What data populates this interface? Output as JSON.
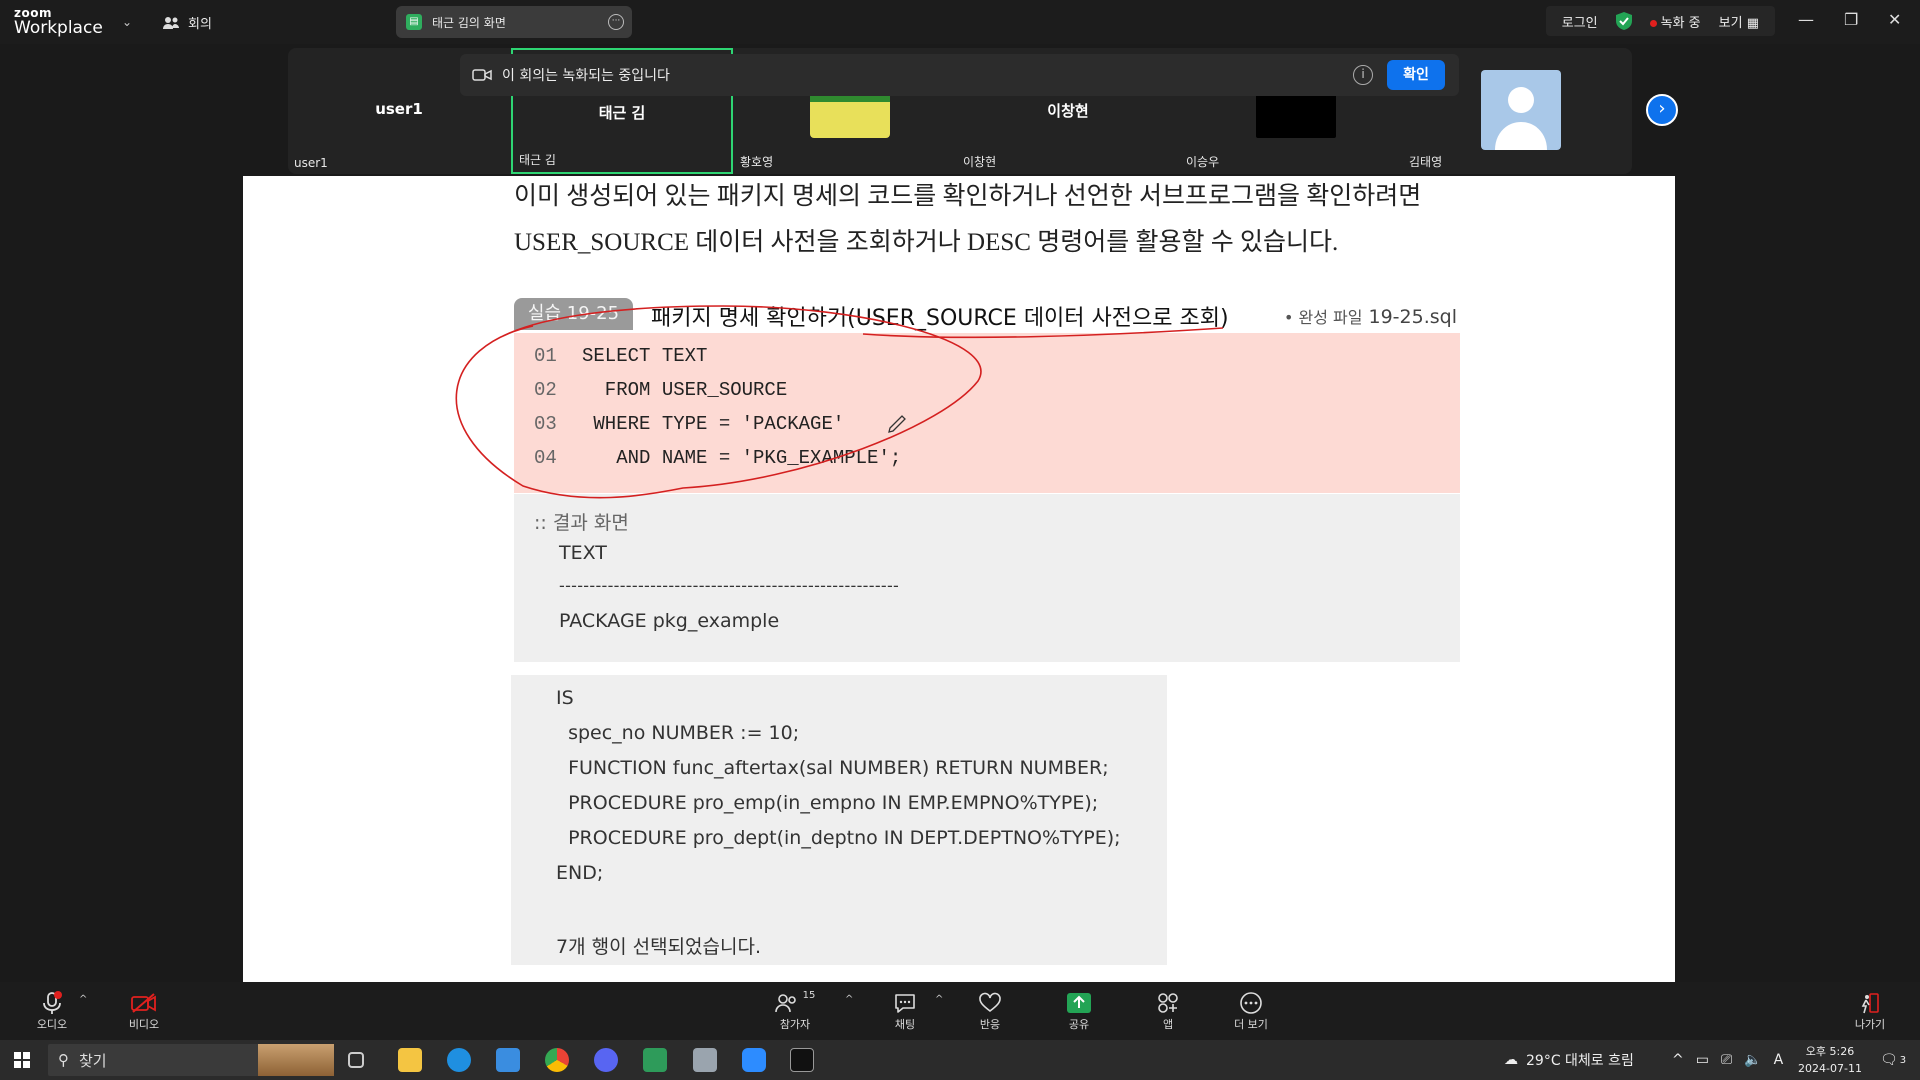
{
  "topbar": {
    "logo_line1": "zoom",
    "logo_line2": "Workplace",
    "meeting_label": "회의",
    "share_title": "태근 김의 화면",
    "login": "로그인",
    "recording": "녹화 중",
    "view": "보기"
  },
  "participants": [
    {
      "name": "user1",
      "label": "user1"
    },
    {
      "name": "태근 김",
      "label": "태근 김"
    },
    {
      "name": "",
      "label": "황호영"
    },
    {
      "name": "이창현",
      "label": "이창현"
    },
    {
      "name": "",
      "label": "이승우"
    },
    {
      "name": "",
      "label": "김태영"
    }
  ],
  "banner": {
    "text": "이 회의는 녹화되는 중입니다",
    "confirm": "확인"
  },
  "document": {
    "para_line1": "이미 생성되어 있는 패키지 명세의 코드를 확인하거나 선언한 서브프로그램을 확인하려면",
    "para_line2": "USER_SOURCE 데이터 사전을 조회하거나 DESC 명령어를 활용할 수 있습니다.",
    "exercise_tag": "실습 19-25",
    "exercise_title": "패키지 명세 확인하기(USER_SOURCE 데이터 사전으로 조회)",
    "file_label": "• 완성 파일",
    "file_name": "19-25.sql",
    "code": [
      {
        "ln": "01",
        "text": "SELECT TEXT"
      },
      {
        "ln": "02",
        "text": "  FROM USER_SOURCE"
      },
      {
        "ln": "03",
        "text": " WHERE TYPE = 'PACKAGE'"
      },
      {
        "ln": "04",
        "text": "   AND NAME = 'PKG_EXAMPLE';"
      }
    ],
    "result_heading": ":: 결과 화면",
    "result_col": "TEXT",
    "result_sep": "--------------------------------------------------------",
    "result_row1": "PACKAGE pkg_example",
    "result_lines": [
      "IS",
      "  spec_no NUMBER := 10;",
      "  FUNCTION func_aftertax(sal NUMBER) RETURN NUMBER;",
      "  PROCEDURE pro_emp(in_empno IN EMP.EMPNO%TYPE);",
      "  PROCEDURE pro_dept(in_deptno IN DEPT.DEPTNO%TYPE);",
      "END;",
      "",
      "7개 행이 선택되었습니다."
    ]
  },
  "toolbar": {
    "audio": "오디오",
    "video": "비디오",
    "participants": "참가자",
    "participants_count": "15",
    "chat": "채팅",
    "react": "반응",
    "share": "공유",
    "apps": "앱",
    "more": "더 보기",
    "leave": "나가기"
  },
  "taskbar": {
    "search": "찾기",
    "weather": "29°C  대체로 흐림",
    "time": "오후 5:26",
    "date": "2024-07-11",
    "notif_count": "3",
    "ime": "A"
  },
  "colors": {
    "accent": "#0e72ed",
    "active_border": "#2ed573",
    "record": "#e0201e",
    "code_bg": "#fddad4",
    "result_bg": "#efefef"
  }
}
